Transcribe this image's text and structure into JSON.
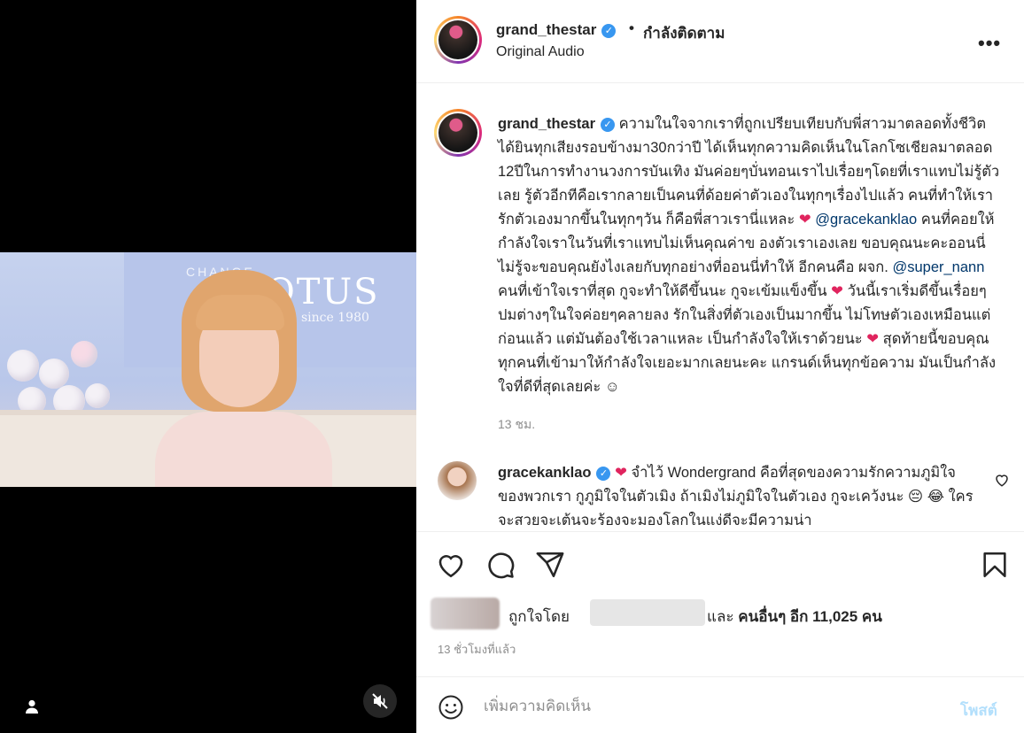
{
  "video": {
    "banner_brand": "CHANGE",
    "banner_title": "OTUS",
    "banner_sub": "since 1980"
  },
  "header": {
    "username": "grand_thestar",
    "dot": "•",
    "follow_status": "กำลังติดตาม",
    "audio": "Original Audio",
    "more": "•••"
  },
  "caption": {
    "username": "grand_thestar",
    "p1": "ความในใจจากเราที่ถูกเปรียบเทียบกับพี่สาวมาตลอดทั้งชีวิต ได้ยินทุกเสียงรอบข้างมา30กว่าปี ได้เห็นทุกความคิดเห็นในโลกโซเชียลมาตลอด 12ปีในการทำงานวงการบันเทิง มันค่อยๆบั่นทอนเราไปเรื่อยๆโดยที่เราแทบไม่รู้ตัวเลย รู้ตัวอีกทีคือเรากลายเป็นคนที่ด้อยค่าตัวเองในทุกๆเรื่องไปแล้ว คนที่ทำให้เรารักตัวเองมากขึ้นในทุกๆวัน ก็คือพี่สาวเรานี่แหละ",
    "mention1": "@gracekanklao",
    "p2": "คนที่คอยให้กำลังใจเราในวันที่เราแทบไม่เห็นคุณค่าข องตัวเราเองเลย ขอบคุณนะคะออนนี่ ไม่รู้จะขอบคุณยังไงเลยกับทุกอย่างที่ออนนี่ทำให้ อีกคนคือ ผจก.",
    "mention2": "@super_nann",
    "p3": "คนที่เข้าใจเราที่สุด กูจะทำให้ดีขึ้นนะ กูจะเข้มแข็งขึ้น",
    "p4": "วันนี้เราเริ่มดีขึ้นเรื่อยๆ ปมต่างๆในใจค่อยๆคลายลง รักในสิ่งที่ตัวเองเป็นมากขึ้น ไม่โทษตัวเองเหมือนแต่ก่อนแล้ว แต่มันต้องใช้เวลาแหละ เป็นกำลังใจให้เราด้วยนะ",
    "p5": "สุดท้ายนี้ขอบคุณทุกคนที่เข้ามาให้กำลังใจเยอะมากเลยนะคะ แกรนด์เห็นทุกข้อความ มันเป็นกำลังใจที่ดีที่สุดเลยค่ะ",
    "heart": "❤",
    "smile": "☺",
    "time": "13 ชม."
  },
  "comment": {
    "username": "gracekanklao",
    "heart": "❤",
    "text1": "จำไว้ Wondergrand คือที่สุดของความรักความภูมิใจของพวกเรา กูภูมิใจในตัวเมิง ถ้าเมิงไม่ภูมิใจในตัวเอง กูจะเคว้งนะ",
    "emoji1": "😔",
    "emoji2": "😂",
    "text2": "ใครจะสวยจะเต้นจะร้องจะมองโลกในแง่ดีจะมีความน่า"
  },
  "likes": {
    "liked_by": "ถูกใจโดย",
    "and": "และ",
    "others": "คนอื่นๆ อีก 11,025 คน"
  },
  "post_time": "13 ชั่วโมงที่แล้ว",
  "comment_box": {
    "placeholder": "เพิ่มความคิดเห็น",
    "post": "โพสต์"
  },
  "icons": {
    "like": "heart-icon",
    "comment": "comment-icon",
    "share": "share-icon",
    "save": "bookmark-icon",
    "emoji": "emoji-icon",
    "mute": "muted-speaker-icon",
    "tag": "user-tag-icon"
  },
  "colors": {
    "link": "#00376b",
    "verified": "#3897f0",
    "post_btn_disabled": "#b2dffc",
    "heart": "#e0245e"
  }
}
